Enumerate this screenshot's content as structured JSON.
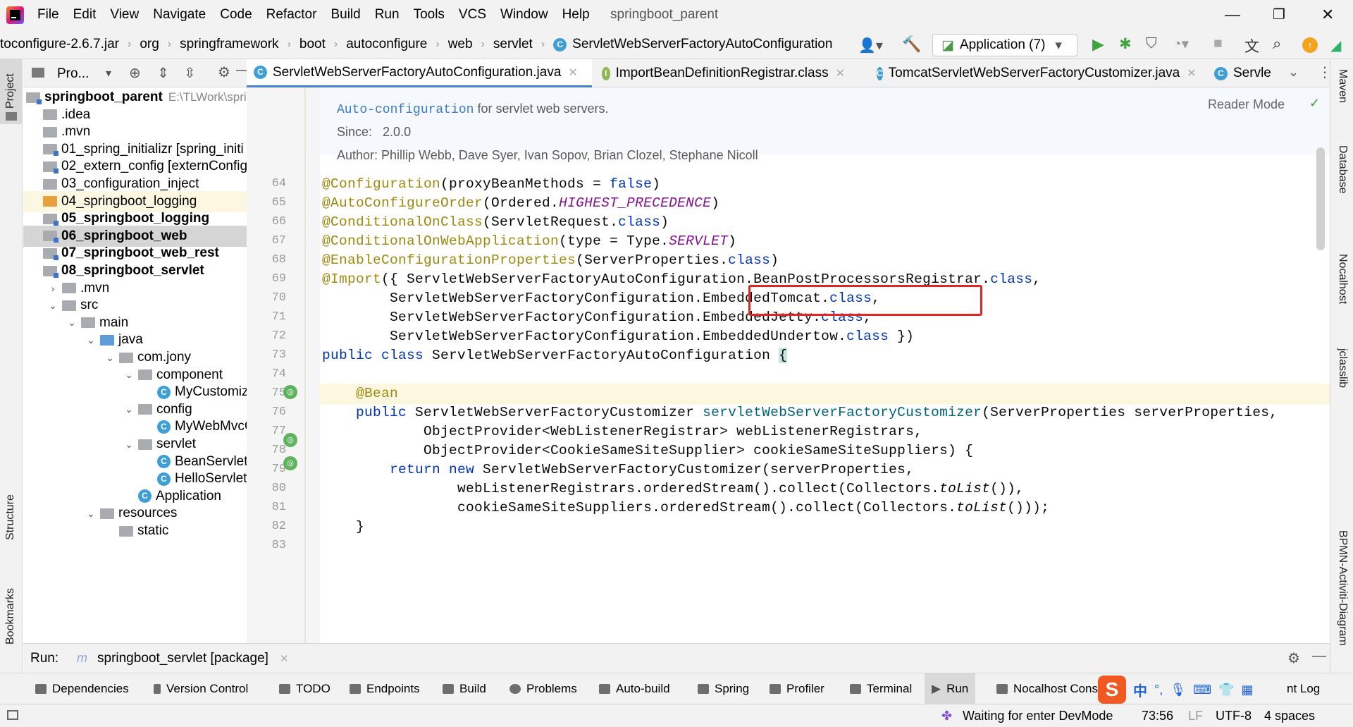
{
  "menubar": {
    "items": [
      "File",
      "Edit",
      "View",
      "Navigate",
      "Code",
      "Refactor",
      "Build",
      "Run",
      "Tools",
      "VCS",
      "Window",
      "Help"
    ],
    "project_title": "springboot_parent"
  },
  "navbar": {
    "crumbs": [
      "toconfigure-2.6.7.jar",
      "org",
      "springframework",
      "boot",
      "autoconfigure",
      "web",
      "servlet",
      "ServletWebServerFactoryAutoConfiguration"
    ],
    "run_config": "Application (7)"
  },
  "left_strip": {
    "project": "Project",
    "structure": "Structure",
    "bookmarks": "Bookmarks"
  },
  "right_strip": {
    "maven": "Maven",
    "database": "Database",
    "nacos": "Nocalhost",
    "jclasslib": "jclasslib",
    "bpmn": "BPMN-Activiti-Diagram"
  },
  "project_panel": {
    "header": "Pro...",
    "tree": [
      {
        "label": "springboot_parent",
        "extra": "E:\\TLWork\\spri",
        "indent": 0,
        "icon": "module",
        "bold": true
      },
      {
        "label": ".idea",
        "indent": 1,
        "icon": "folder"
      },
      {
        "label": ".mvn",
        "indent": 1,
        "icon": "folder"
      },
      {
        "label": "01_spring_initializr [spring_initi",
        "indent": 1,
        "icon": "module",
        "bold": false
      },
      {
        "label": "02_extern_config [externConfig",
        "indent": 1,
        "icon": "module"
      },
      {
        "label": "03_configuration_inject",
        "indent": 1,
        "icon": "folder"
      },
      {
        "label": "04_springboot_logging",
        "indent": 1,
        "icon": "orange",
        "highlight": true
      },
      {
        "label": "05_springboot_logging",
        "indent": 1,
        "icon": "module",
        "bold": true
      },
      {
        "label": "06_springboot_web",
        "indent": 1,
        "icon": "module",
        "bold": true,
        "selected": true
      },
      {
        "label": "07_springboot_web_rest",
        "indent": 1,
        "icon": "module",
        "bold": true
      },
      {
        "label": "08_springboot_servlet",
        "indent": 1,
        "icon": "module",
        "bold": true
      },
      {
        "label": ".mvn",
        "indent": 2,
        "icon": "folder",
        "chev": "›"
      },
      {
        "label": "src",
        "indent": 2,
        "icon": "folder",
        "chev": "⌄"
      },
      {
        "label": "main",
        "indent": 3,
        "icon": "folder",
        "chev": "⌄"
      },
      {
        "label": "java",
        "indent": 4,
        "icon": "java",
        "chev": "⌄"
      },
      {
        "label": "com.jony",
        "indent": 5,
        "icon": "folder",
        "chev": "⌄"
      },
      {
        "label": "component",
        "indent": 6,
        "icon": "folder",
        "chev": "⌄"
      },
      {
        "label": "MyCustomize",
        "indent": 7,
        "icon": "class"
      },
      {
        "label": "config",
        "indent": 6,
        "icon": "folder",
        "chev": "⌄"
      },
      {
        "label": "MyWebMvcC",
        "indent": 7,
        "icon": "class"
      },
      {
        "label": "servlet",
        "indent": 6,
        "icon": "folder",
        "chev": "⌄"
      },
      {
        "label": "BeanServlet",
        "indent": 7,
        "icon": "class"
      },
      {
        "label": "HelloServlet",
        "indent": 7,
        "icon": "class"
      },
      {
        "label": "Application",
        "indent": 6,
        "icon": "class"
      },
      {
        "label": "resources",
        "indent": 4,
        "icon": "folder",
        "chev": "⌄"
      },
      {
        "label": "static",
        "indent": 5,
        "icon": "folder"
      }
    ]
  },
  "tabs": [
    {
      "label": "ServletWebServerFactoryAutoConfiguration.java",
      "icon": "C",
      "active": true
    },
    {
      "label": "ImportBeanDefinitionRegistrar.class",
      "icon": "I"
    },
    {
      "label": "TomcatServletWebServerFactoryCustomizer.java",
      "icon": "C"
    },
    {
      "label": "Servle",
      "icon": "C"
    }
  ],
  "editor": {
    "reader_mode": "Reader Mode",
    "doc": {
      "line1_code": "Auto-configuration",
      "line1_text": " for servlet web servers.",
      "since_label": "Since:",
      "since_value": "2.0.0",
      "author": "Author: Phillip Webb, Dave Syer, Ivan Sopov, Brian Clozel, Stephane Nicoll"
    },
    "line_numbers": [
      "64",
      "65",
      "66",
      "67",
      "68",
      "69",
      "70",
      "71",
      "72",
      "73",
      "74",
      "75",
      "76",
      "77",
      "78",
      "79",
      "80",
      "81",
      "82",
      "83"
    ],
    "highlighted_text": "BeanPostProcessorsRegistrar"
  },
  "runbar": {
    "label": "Run:",
    "config": "springboot_servlet [package]"
  },
  "toolwindows": [
    "Dependencies",
    "Version Control",
    "TODO",
    "Endpoints",
    "Build",
    "Problems",
    "Auto-build",
    "Spring",
    "Profiler",
    "Terminal",
    "Run",
    "Nocalhost Cons",
    "nt Log"
  ],
  "statusbar": {
    "message": "Waiting for enter DevMode",
    "position": "73:56",
    "line_sep": "LF",
    "encoding": "UTF-8",
    "indent": "4 spaces"
  },
  "ime": {
    "lang": "中"
  }
}
